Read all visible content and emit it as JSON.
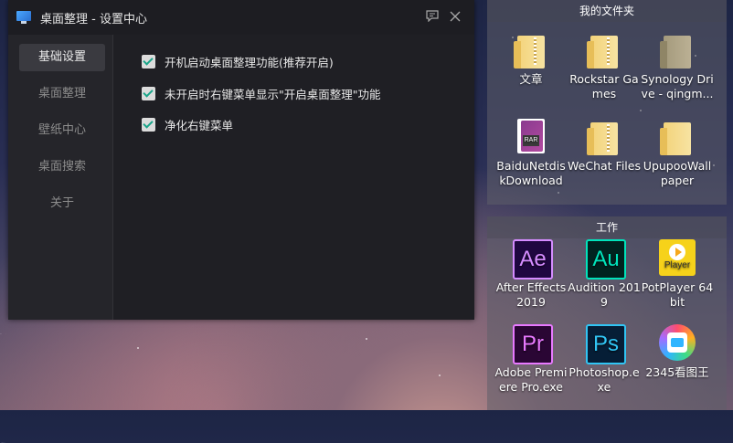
{
  "window": {
    "title": "桌面整理 - 设置中心",
    "feedback_icon": "feedback-icon",
    "close_icon": "close-icon"
  },
  "sidebar": {
    "items": [
      {
        "label": "基础设置",
        "active": true
      },
      {
        "label": "桌面整理",
        "active": false
      },
      {
        "label": "壁纸中心",
        "active": false
      },
      {
        "label": "桌面搜索",
        "active": false
      },
      {
        "label": "关于",
        "active": false
      }
    ]
  },
  "options": [
    {
      "label": "开机启动桌面整理功能(推荐开启)",
      "checked": true
    },
    {
      "label": "未开启时右键菜单显示\"开启桌面整理\"功能",
      "checked": true
    },
    {
      "label": "净化右键菜单",
      "checked": true
    }
  ],
  "panels": {
    "my_files": {
      "title": "我的文件夹",
      "items": [
        {
          "label": "文章",
          "icon": "folder-icon"
        },
        {
          "label": "Rockstar Games",
          "icon": "folder-icon"
        },
        {
          "label": "Synology Drive - qingm...",
          "icon": "folder-icon"
        },
        {
          "label": "BaiduNetdiskDownload",
          "icon": "rar-file-icon"
        },
        {
          "label": "WeChat Files",
          "icon": "folder-icon"
        },
        {
          "label": "UpupooWallpaper",
          "icon": "folder-icon"
        }
      ]
    },
    "work": {
      "title": "工作",
      "items": [
        {
          "label": "After Effects 2019",
          "icon": "after-effects-icon",
          "glyph": "Ae"
        },
        {
          "label": "Audition 2019",
          "icon": "audition-icon",
          "glyph": "Au"
        },
        {
          "label": "PotPlayer 64 bit",
          "icon": "potplayer-icon",
          "glyph": "Player"
        },
        {
          "label": "Adobe Premiere Pro.exe",
          "icon": "premiere-icon",
          "glyph": "Pr"
        },
        {
          "label": "Photoshop.exe",
          "icon": "photoshop-icon",
          "glyph": "Ps"
        },
        {
          "label": "2345看图王",
          "icon": "2345-viewer-icon"
        }
      ]
    }
  },
  "colors": {
    "accent_check": "#1aa58a",
    "window_bg": "#25252a",
    "content_bg": "#1f1f24"
  }
}
